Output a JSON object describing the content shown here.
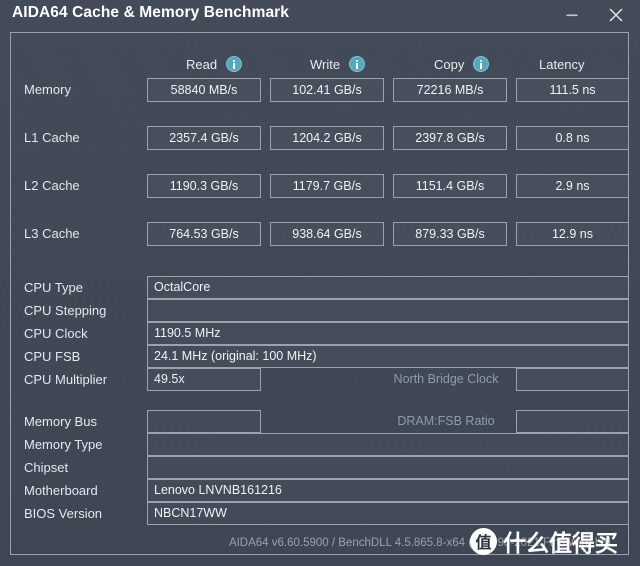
{
  "window": {
    "title": "AIDA64 Cache & Memory Benchmark",
    "minimize_icon": "minimize-icon",
    "close_icon": "close-icon"
  },
  "benchmark": {
    "columns": [
      {
        "label": "Read",
        "has_info": true
      },
      {
        "label": "Write",
        "has_info": true
      },
      {
        "label": "Copy",
        "has_info": true
      },
      {
        "label": "Latency",
        "has_info": false
      }
    ],
    "rows": [
      {
        "label": "Memory",
        "read": "58840 MB/s",
        "write": "102.41 GB/s",
        "copy": "72216 MB/s",
        "latency": "111.5 ns"
      },
      {
        "label": "L1 Cache",
        "read": "2357.4 GB/s",
        "write": "1204.2 GB/s",
        "copy": "2397.8 GB/s",
        "latency": "0.8 ns"
      },
      {
        "label": "L2 Cache",
        "read": "1190.3 GB/s",
        "write": "1179.7 GB/s",
        "copy": "1151.4 GB/s",
        "latency": "2.9 ns"
      },
      {
        "label": "L3 Cache",
        "read": "764.53 GB/s",
        "write": "938.64 GB/s",
        "copy": "879.33 GB/s",
        "latency": "12.9 ns"
      }
    ]
  },
  "system_info": {
    "cpu_type": {
      "label": "CPU Type",
      "value": "OctalCore"
    },
    "cpu_stepping": {
      "label": "CPU Stepping",
      "value": ""
    },
    "cpu_clock": {
      "label": "CPU Clock",
      "value": "1190.5 MHz"
    },
    "cpu_fsb": {
      "label": "CPU FSB",
      "value": "24.1 MHz  (original: 100 MHz)"
    },
    "cpu_multiplier": {
      "label": "CPU Multiplier",
      "value": "49.5x"
    },
    "north_bridge": {
      "label": "North Bridge Clock",
      "value": ""
    },
    "memory_bus": {
      "label": "Memory Bus",
      "value": ""
    },
    "dram_fsb_ratio": {
      "label": "DRAM:FSB Ratio",
      "value": ""
    },
    "memory_type": {
      "label": "Memory Type",
      "value": ""
    },
    "chipset": {
      "label": "Chipset",
      "value": ""
    },
    "motherboard": {
      "label": "Motherboard",
      "value": "Lenovo LNVNB161216"
    },
    "bios_version": {
      "label": "BIOS Version",
      "value": "NBCN17WW"
    }
  },
  "footer": {
    "text": "AIDA64 v6.60.5900 / BenchDLL 4.5.865.8-x64  (c) 1995-2021 FinalWire Ltd."
  },
  "watermark": {
    "badge": "值",
    "text": "什么值得买"
  },
  "colors": {
    "background": "#3f4654",
    "border": "#9aa2b0",
    "text": "#e8eaee",
    "muted_text": "#8e9bb0",
    "info_icon": "#5aa7bb"
  }
}
